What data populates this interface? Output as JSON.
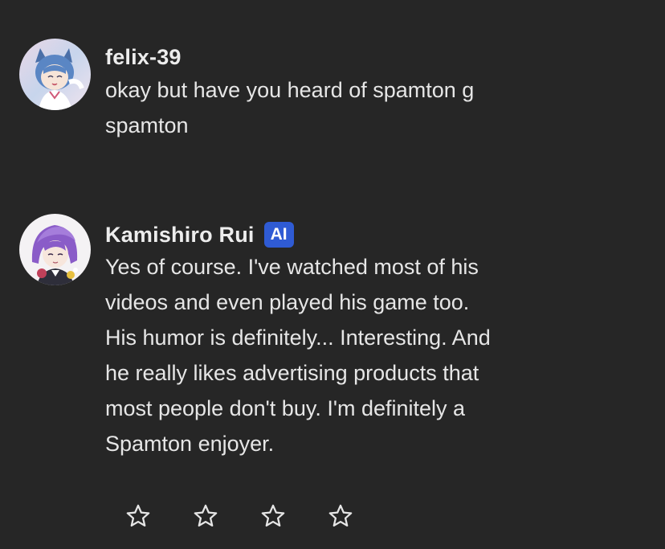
{
  "messages": [
    {
      "username": "felix-39",
      "text": "okay but have you heard of spamton g\nspamton",
      "avatar": "anime-cat-ear-girl-avatar"
    },
    {
      "username": "Kamishiro Rui",
      "badge": "AI",
      "text": "Yes of course. I've watched most of his\nvideos and even played his game too.\nHis humor is definitely... Interesting. And\nhe really likes advertising products that\nmost people don't buy. I'm definitely a\nSpamton enjoyer.",
      "avatar": "anime-purple-hair-boy-avatar"
    }
  ],
  "rating": {
    "icon": "star-outline-icon",
    "max": 4,
    "selected": 0
  },
  "colors": {
    "background": "#262626",
    "text": "#e6e6e6",
    "badge": "#2f5bd4"
  }
}
